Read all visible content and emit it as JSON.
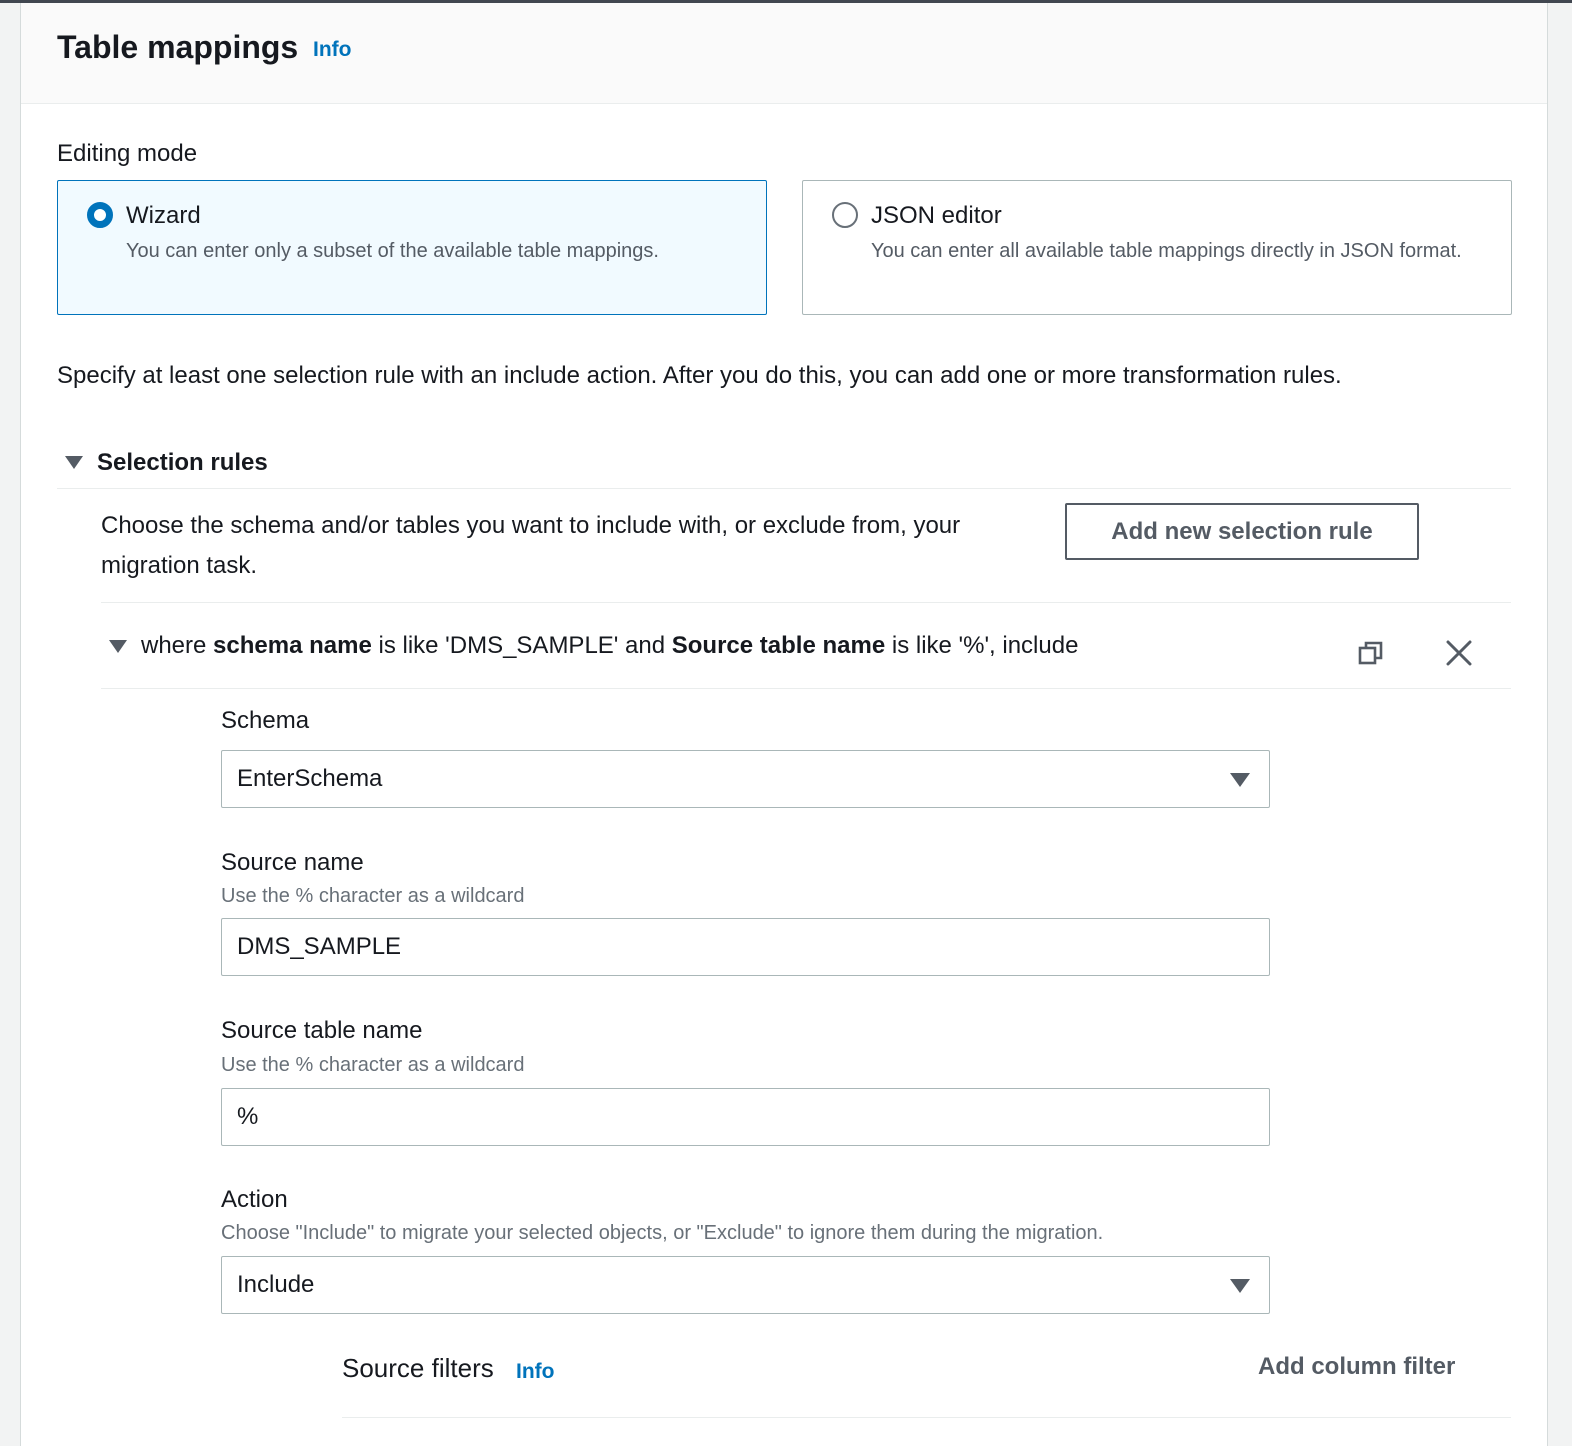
{
  "panel": {
    "title": "Table mappings",
    "info_link": "Info"
  },
  "editing_mode": {
    "label": "Editing mode",
    "options": [
      {
        "title": "Wizard",
        "description": "You can enter only a subset of the available table mappings.",
        "selected": true
      },
      {
        "title": "JSON editor",
        "description": "You can enter all available table mappings directly in JSON format.",
        "selected": false
      }
    ]
  },
  "instructions": "Specify at least one selection rule with an include action. After you do this, you can add one or more transformation rules.",
  "selection_rules": {
    "title": "Selection rules",
    "expanded": true,
    "description": "Choose the schema and/or tables you want to include with, or exclude from, your migration task.",
    "add_button": "Add new selection rule"
  },
  "rule": {
    "expanded": true,
    "summary": {
      "p1": "where ",
      "b1": "schema name",
      "p2": " is like 'DMS_SAMPLE' and ",
      "b2": "Source table name",
      "p3": " is like '%', include"
    },
    "copy_icon": "copy-icon",
    "close_icon": "close-icon",
    "schema": {
      "label": "Schema",
      "value": "EnterSchema"
    },
    "source_name": {
      "label": "Source name",
      "hint": "Use the % character as a wildcard",
      "value": "DMS_SAMPLE"
    },
    "source_table_name": {
      "label": "Source table name",
      "hint": "Use the % character as a wildcard",
      "value": "%"
    },
    "action": {
      "label": "Action",
      "hint": "Choose \"Include\" to migrate your selected objects, or \"Exclude\" to ignore them during the migration.",
      "value": "Include"
    },
    "source_filters": {
      "title": "Source filters",
      "info_link": "Info",
      "add_button": "Add column filter"
    }
  },
  "colors": {
    "accent": "#0073bb",
    "selected_tile_bg": "#f1faff",
    "text": "#16191f",
    "secondary_text": "#545b64",
    "hint_text": "#687078"
  }
}
